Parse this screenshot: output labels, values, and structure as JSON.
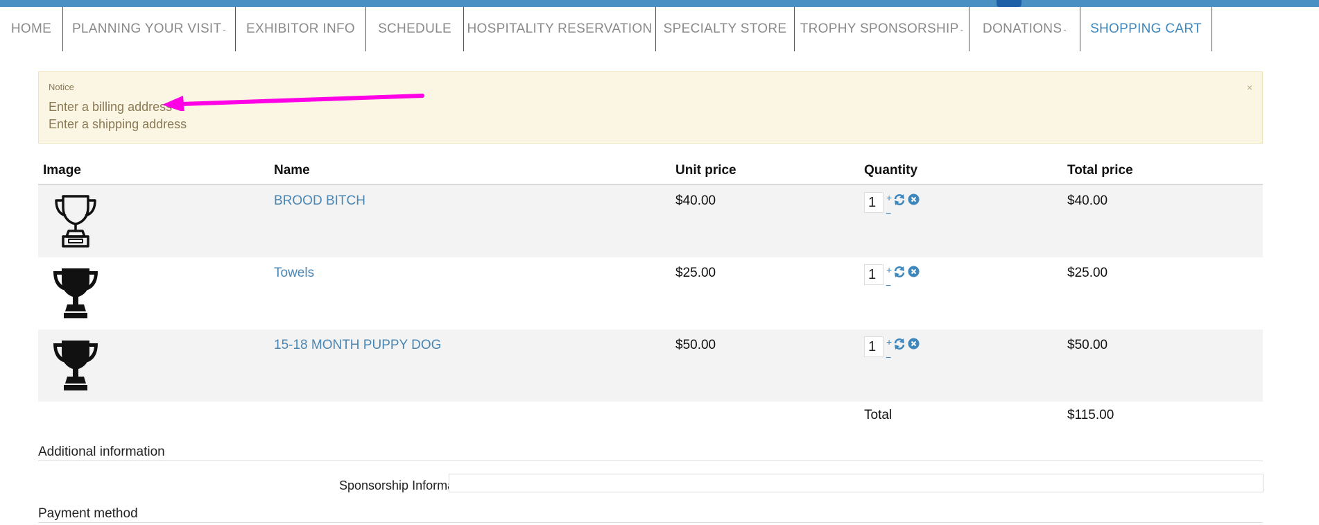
{
  "nav": {
    "items": [
      {
        "label": "HOME",
        "dropdown": false
      },
      {
        "label": "PLANNING YOUR VISIT",
        "dropdown": true
      },
      {
        "label": "EXHIBITOR INFO",
        "dropdown": false
      },
      {
        "label": "SCHEDULE",
        "dropdown": false
      },
      {
        "label": "HOSPITALITY RESERVATION",
        "dropdown": false
      },
      {
        "label": "SPECIALTY STORE",
        "dropdown": false
      },
      {
        "label": "TROPHY SPONSORSHIP",
        "dropdown": true
      },
      {
        "label": "DONATIONS",
        "dropdown": true
      },
      {
        "label": "SHOPPING CART",
        "dropdown": false,
        "active": true
      }
    ],
    "caret": "-"
  },
  "notice": {
    "title": "Notice",
    "messages": [
      "Enter a billing address",
      "Enter a shipping address"
    ],
    "close": "×"
  },
  "cart": {
    "headers": {
      "image": "Image",
      "name": "Name",
      "unit_price": "Unit price",
      "quantity": "Quantity",
      "total_price": "Total price"
    },
    "rows": [
      {
        "icon": "trophy-outline-icon",
        "name": "BROOD BITCH",
        "unit_price": "$40.00",
        "quantity": "1",
        "plus": "+",
        "minus": "−",
        "total_price": "$40.00"
      },
      {
        "icon": "trophy-solid-icon",
        "name": "Towels",
        "unit_price": "$25.00",
        "quantity": "1",
        "plus": "+",
        "minus": "−",
        "total_price": "$25.00"
      },
      {
        "icon": "trophy-solid-icon",
        "name": "15-18 MONTH PUPPY DOG",
        "unit_price": "$50.00",
        "quantity": "1",
        "plus": "+",
        "minus": "−",
        "total_price": "$50.00"
      }
    ],
    "total_label": "Total",
    "total_value": "$115.00"
  },
  "additional": {
    "title": "Additional information",
    "sponsorship_label": "Sponsorship Information",
    "sponsorship_value": ""
  },
  "payment": {
    "title": "Payment method"
  },
  "colors": {
    "accent": "#3d87bd",
    "topbar": "#4a90c2",
    "arrow": "#ff00e6",
    "notice_bg": "#fbf5e4"
  }
}
